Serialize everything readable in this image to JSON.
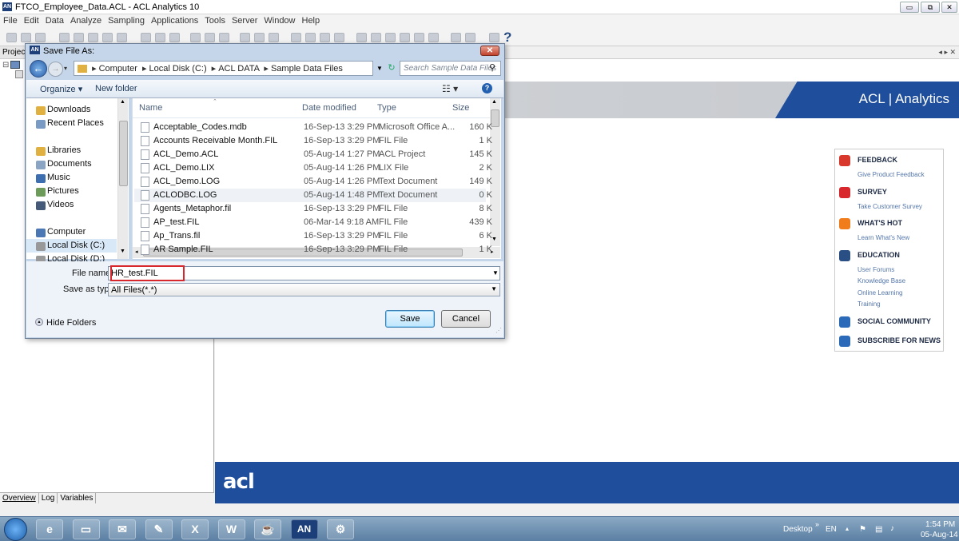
{
  "window": {
    "title": "FTCO_Employee_Data.ACL - ACL Analytics 10",
    "icon_label": "AN",
    "controls": [
      "▭",
      "⧉",
      "✕"
    ]
  },
  "menu": [
    "File",
    "Edit",
    "Data",
    "Analyze",
    "Sampling",
    "Applications",
    "Tools",
    "Server",
    "Window",
    "Help"
  ],
  "project_panel": {
    "header": "Project",
    "tabs": [
      "Overview",
      "Log",
      "Variables"
    ]
  },
  "content": {
    "tab_controls": "◂ ▸ ✕",
    "banner_logo": "ACL | Analytics",
    "footer_logo": "acl",
    "news": [
      {
        "heading": "FEEDBACK",
        "icon": "feedback-icon",
        "color": "#d9382c",
        "links": [
          "Give Product Feedback"
        ]
      },
      {
        "heading": "SURVEY",
        "icon": "checkmark-icon",
        "color": "#d9282d",
        "links": [
          "Take Customer Survey"
        ]
      },
      {
        "heading": "WHAT'S HOT",
        "icon": "starburst-icon",
        "color": "#f07c1c",
        "links": [
          "Learn What's New"
        ]
      },
      {
        "heading": "EDUCATION",
        "icon": "books-icon",
        "color": "#2a4f85",
        "links": [
          "User Forums",
          "Knowledge Base",
          "Online Learning",
          "Training"
        ]
      },
      {
        "heading": "SOCIAL COMMUNITY",
        "icon": "chat-icon",
        "color": "#2a6ab8",
        "links": []
      },
      {
        "heading": "SUBSCRIBE FOR NEWS",
        "icon": "newsletter-icon",
        "color": "#2a6ab8",
        "links": []
      }
    ]
  },
  "dialog": {
    "title": "Save File As:",
    "icon_label": "AN",
    "close": "✕",
    "back": "←",
    "forward": "→",
    "address": [
      "Computer",
      "Local Disk (C:)",
      "ACL DATA",
      "Sample Data Files"
    ],
    "search_placeholder": "Search Sample Data Files",
    "organize": "Organize ▾",
    "new_folder": "New folder",
    "views": "☷ ▾",
    "help": "?",
    "nav": [
      {
        "label": "Downloads",
        "icon": "downloads-icon",
        "color": "#e0b040"
      },
      {
        "label": "Recent Places",
        "icon": "recent-places-icon",
        "color": "#7a9cc4"
      },
      {
        "label": "Libraries",
        "icon": "libraries-icon",
        "color": "#e0b040"
      },
      {
        "label": "Documents",
        "icon": "documents-icon",
        "color": "#8aa4c4"
      },
      {
        "label": "Music",
        "icon": "music-icon",
        "color": "#3d6fb0"
      },
      {
        "label": "Pictures",
        "icon": "pictures-icon",
        "color": "#6d9c5a"
      },
      {
        "label": "Videos",
        "icon": "videos-icon",
        "color": "#445a78"
      },
      {
        "label": "Computer",
        "icon": "computer-icon",
        "color": "#4b78b5"
      },
      {
        "label": "Local Disk (C:)",
        "icon": "drive-c-icon",
        "color": "#999"
      },
      {
        "label": "Local Disk (D:)",
        "icon": "drive-d-icon",
        "color": "#999"
      }
    ],
    "columns": [
      "Name",
      "Date modified",
      "Type",
      "Size"
    ],
    "files": [
      {
        "name": "Acceptable_Codes.mdb",
        "date": "16-Sep-13 3:29 PM",
        "type": "Microsoft Office A...",
        "size": "160 K"
      },
      {
        "name": "Accounts Receivable Month.FIL",
        "date": "16-Sep-13 3:29 PM",
        "type": "FIL File",
        "size": "1 K"
      },
      {
        "name": "ACL_Demo.ACL",
        "date": "05-Aug-14 1:27 PM",
        "type": "ACL Project",
        "size": "145 K"
      },
      {
        "name": "ACL_Demo.LIX",
        "date": "05-Aug-14 1:26 PM",
        "type": "LIX File",
        "size": "2 K"
      },
      {
        "name": "ACL_Demo.LOG",
        "date": "05-Aug-14 1:26 PM",
        "type": "Text Document",
        "size": "149 K"
      },
      {
        "name": "ACLODBC.LOG",
        "date": "05-Aug-14 1:48 PM",
        "type": "Text Document",
        "size": "0 K"
      },
      {
        "name": "Agents_Metaphor.fil",
        "date": "16-Sep-13 3:29 PM",
        "type": "FIL File",
        "size": "8 K"
      },
      {
        "name": "AP_test.FIL",
        "date": "06-Mar-14 9:18 AM",
        "type": "FIL File",
        "size": "439 K"
      },
      {
        "name": "Ap_Trans.fil",
        "date": "16-Sep-13 3:29 PM",
        "type": "FIL File",
        "size": "6 K"
      },
      {
        "name": "AR Sample.FIL",
        "date": "16-Sep-13 3:29 PM",
        "type": "FIL File",
        "size": "1 K"
      }
    ],
    "file_name_label": "File name:",
    "file_name_value": "HR_test.FIL",
    "save_type_label": "Save as type:",
    "save_type_value": "All Files(*.*)",
    "hide_folders": "Hide Folders",
    "save": "Save",
    "cancel": "Cancel"
  },
  "taskbar": {
    "apps": [
      {
        "name": "ie-icon",
        "glyph": "e"
      },
      {
        "name": "explorer-icon",
        "glyph": "▭"
      },
      {
        "name": "outlook-icon",
        "glyph": "✉"
      },
      {
        "name": "notepad-icon",
        "glyph": "✎"
      },
      {
        "name": "excel-icon",
        "glyph": "X"
      },
      {
        "name": "word-icon",
        "glyph": "W"
      },
      {
        "name": "java-icon",
        "glyph": "☕"
      },
      {
        "name": "acl-app-icon",
        "glyph": "AN"
      },
      {
        "name": "settings-app-icon",
        "glyph": "⚙"
      }
    ],
    "desktop": "Desktop",
    "chevron": "»",
    "lang": "EN",
    "time": "1:54 PM",
    "date": "05-Aug-14"
  }
}
